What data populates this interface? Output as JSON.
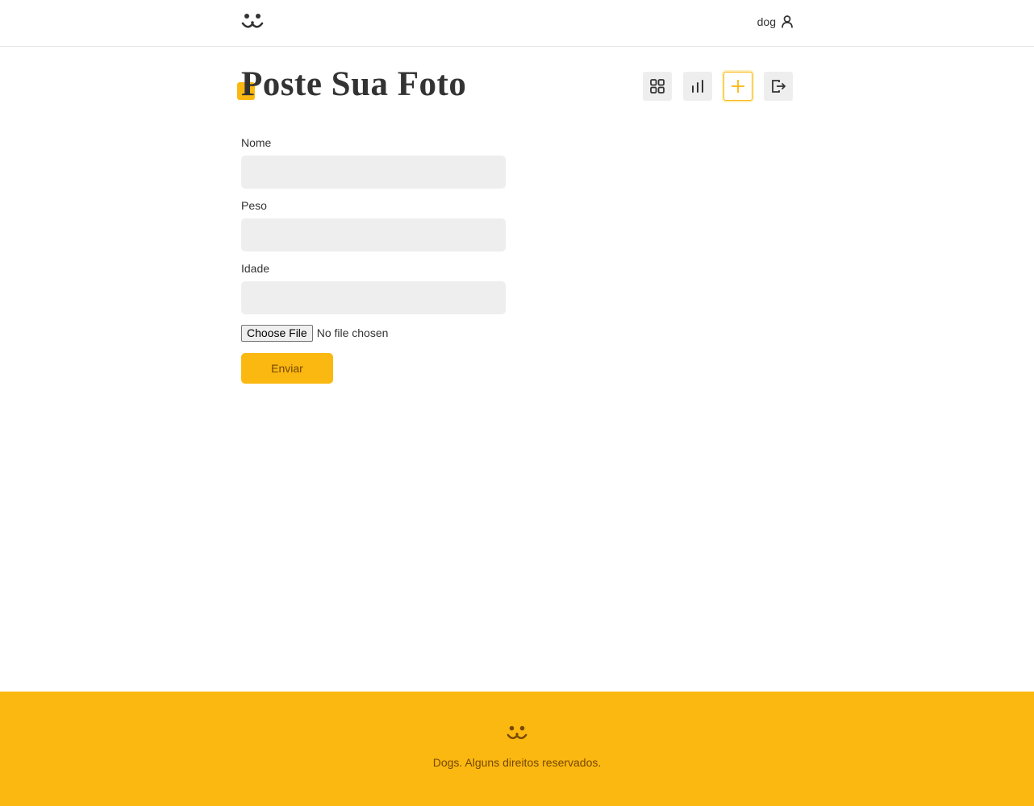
{
  "header": {
    "logo_icon": "dog-face-icon",
    "user_label": "dog",
    "user_icon": "user-icon"
  },
  "page": {
    "title": "Poste Sua Foto"
  },
  "nav": {
    "items": [
      {
        "icon": "grid-icon",
        "active": false
      },
      {
        "icon": "bar-chart-icon",
        "active": false
      },
      {
        "icon": "plus-icon",
        "active": true
      },
      {
        "icon": "logout-icon",
        "active": false
      }
    ]
  },
  "form": {
    "nome_label": "Nome",
    "nome_value": "",
    "peso_label": "Peso",
    "peso_value": "",
    "idade_label": "Idade",
    "idade_value": "",
    "file_button_label": "Choose File",
    "file_status": "No file chosen",
    "submit_label": "Enviar"
  },
  "footer": {
    "logo_icon": "dog-face-icon",
    "text": "Dogs. Alguns direitos reservados."
  },
  "colors": {
    "accent": "#fbb811",
    "accent_text": "#764701",
    "text": "#333333",
    "input_bg": "#eeeeee"
  }
}
